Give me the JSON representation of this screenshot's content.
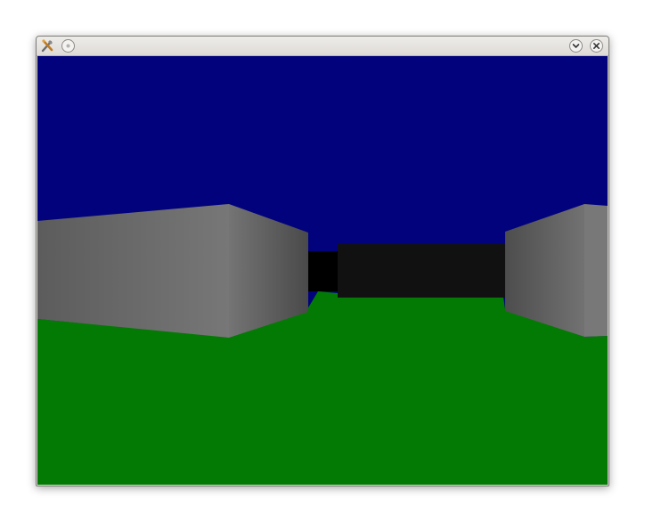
{
  "window": {
    "title": "",
    "icons": {
      "app": "tools-icon",
      "menu": "circle-menu-icon",
      "minimize": "chevron-down-icon",
      "close": "close-icon"
    }
  },
  "scene": {
    "sky_color": "#02027d",
    "floor_color": "#037a03",
    "wall_colors": {
      "near_face": "#747474",
      "side_face": "#5e5e5e",
      "far_wall": "#111111",
      "gap": "#000000"
    }
  }
}
